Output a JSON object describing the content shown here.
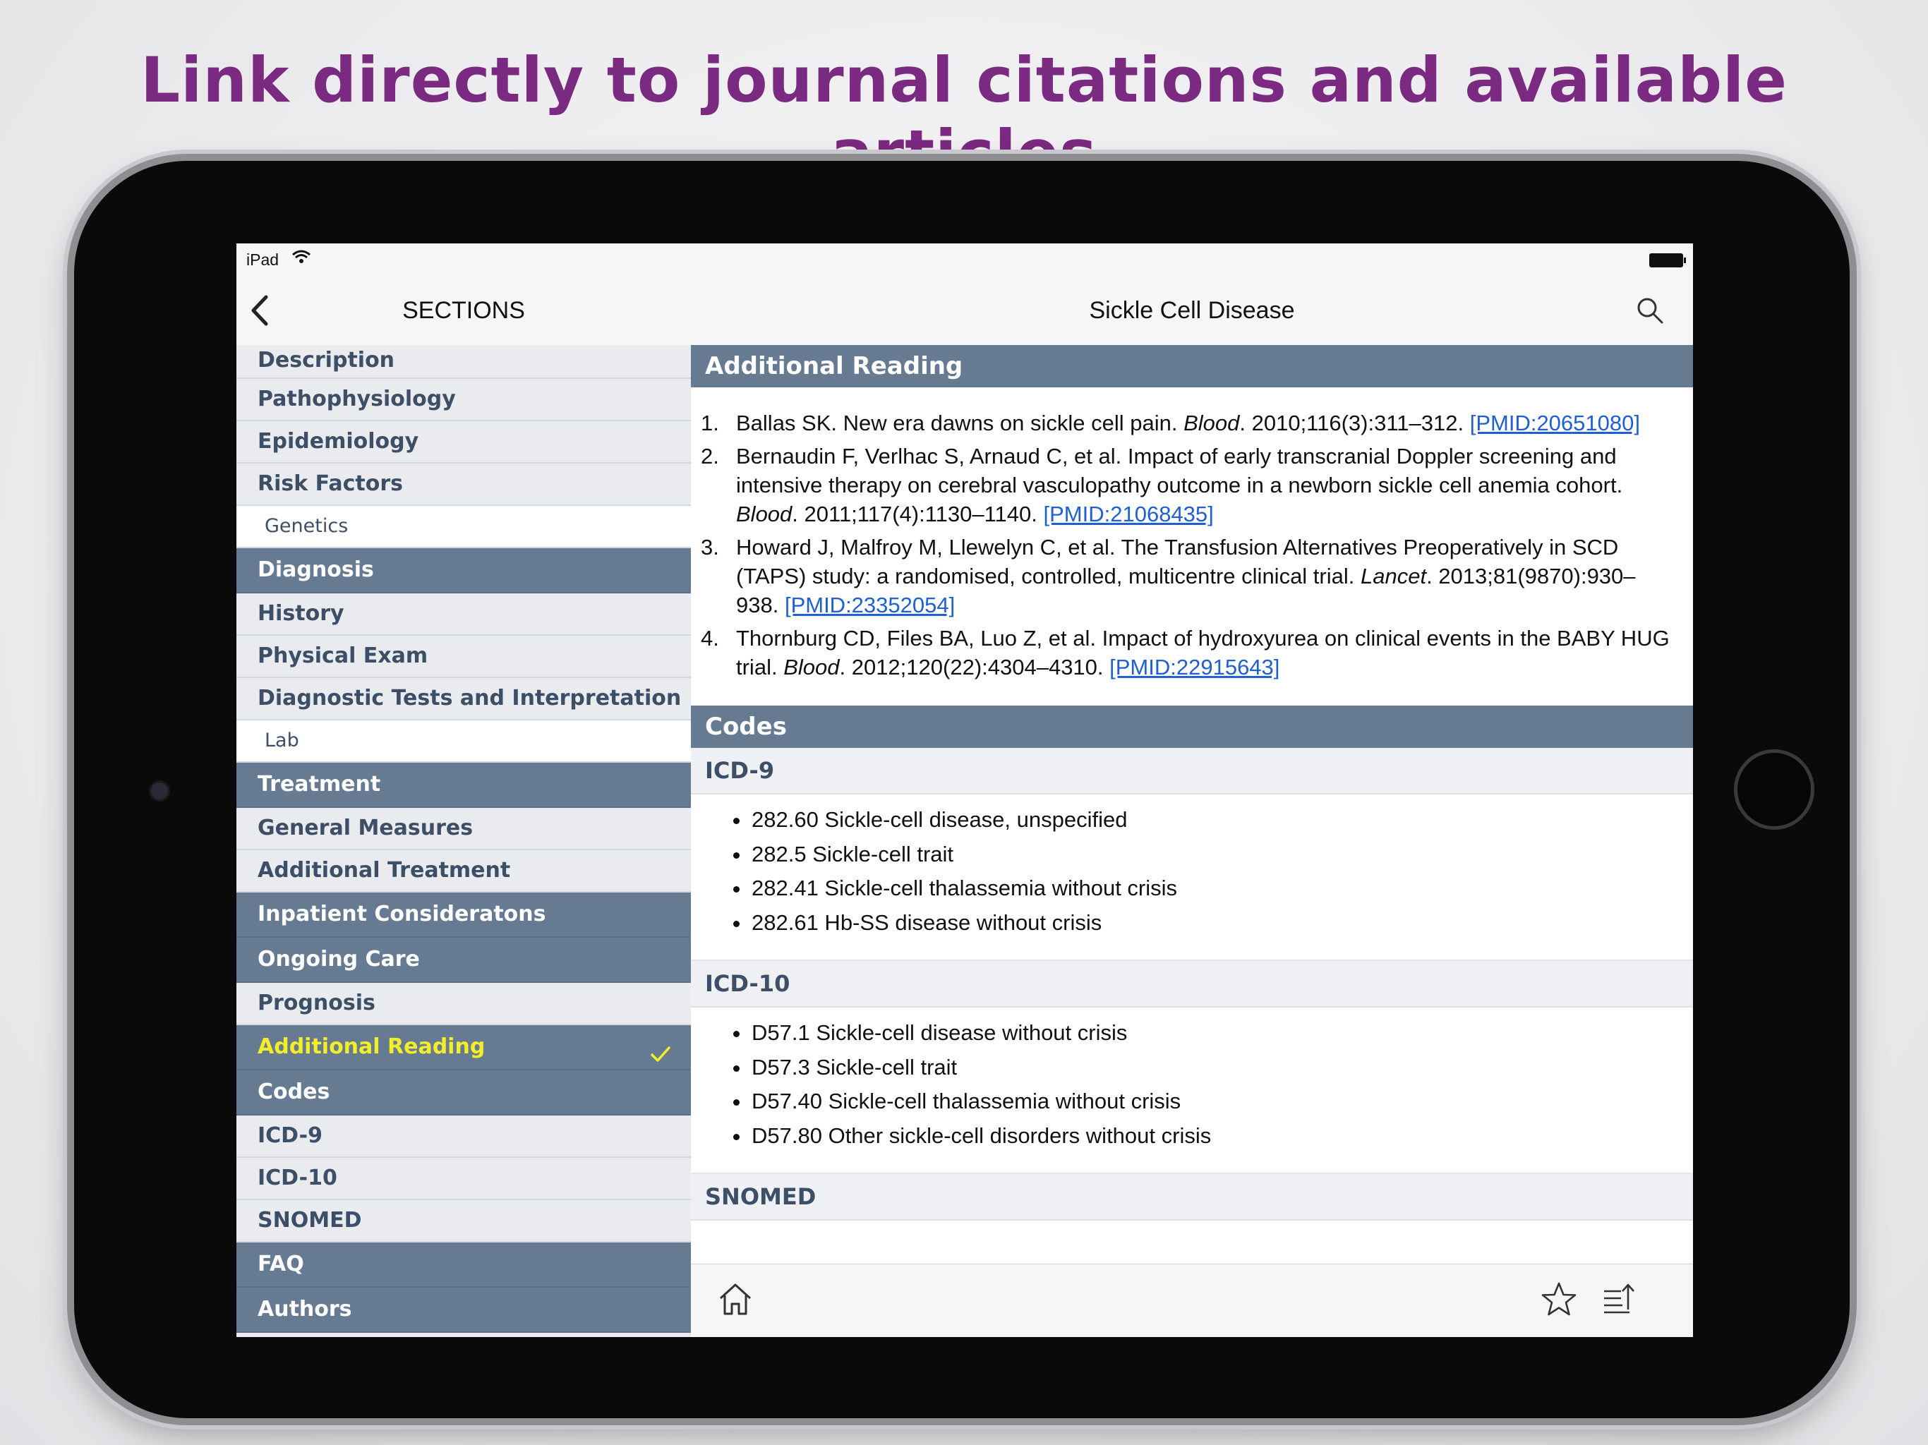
{
  "headline": "Link directly to journal citations and available articles",
  "status_bar": {
    "carrier": "iPad"
  },
  "sidebar": {
    "title": "SECTIONS",
    "items": [
      {
        "label": "Description",
        "type": "item"
      },
      {
        "label": "Pathophysiology",
        "type": "item"
      },
      {
        "label": "Epidemiology",
        "type": "item"
      },
      {
        "label": "Risk Factors",
        "type": "item"
      },
      {
        "label": "Genetics",
        "type": "sub"
      },
      {
        "label": "Diagnosis",
        "type": "head"
      },
      {
        "label": "History",
        "type": "item"
      },
      {
        "label": "Physical Exam",
        "type": "item"
      },
      {
        "label": "Diagnostic Tests and Interpretation",
        "type": "item"
      },
      {
        "label": "Lab",
        "type": "sub"
      },
      {
        "label": "Treatment",
        "type": "head"
      },
      {
        "label": "General Measures",
        "type": "item"
      },
      {
        "label": "Additional Treatment",
        "type": "item"
      },
      {
        "label": "Inpatient Consideratons",
        "type": "head"
      },
      {
        "label": "Ongoing Care",
        "type": "head"
      },
      {
        "label": "Prognosis",
        "type": "item"
      },
      {
        "label": "Additional Reading",
        "type": "active"
      },
      {
        "label": "Codes",
        "type": "head"
      },
      {
        "label": "ICD-9",
        "type": "item"
      },
      {
        "label": "ICD-10",
        "type": "item"
      },
      {
        "label": "SNOMED",
        "type": "item"
      },
      {
        "label": "FAQ",
        "type": "head"
      },
      {
        "label": "Authors",
        "type": "head"
      }
    ]
  },
  "main": {
    "title": "Sickle Cell Disease",
    "additional_reading": {
      "heading": "Additional Reading",
      "references": [
        {
          "num": "1.",
          "before": "Ballas SK. New era dawns on sickle cell pain. ",
          "journal": "Blood",
          "after": ". 2010;116(3):311–312. ",
          "pmid": "[PMID:20651080]"
        },
        {
          "num": "2.",
          "before": "Bernaudin F, Verlhac S, Arnaud C, et al. Impact of early transcranial Doppler screening and intensive therapy on cerebral vasculopathy outcome in a newborn sickle cell anemia cohort. ",
          "journal": "Blood",
          "after": ". 2011;117(4):1130–1140. ",
          "pmid": "[PMID:21068435]"
        },
        {
          "num": "3.",
          "before": "Howard J, Malfroy M, Llewelyn C, et al. The Transfusion Alternatives Preoperatively in SCD (TAPS) study: a randomised, controlled, multicentre clinical trial. ",
          "journal": "Lancet",
          "after": ". 2013;81(9870):930–938. ",
          "pmid": "[PMID:23352054]"
        },
        {
          "num": "4.",
          "before": "Thornburg CD, Files BA, Luo Z, et al. Impact of hydroxyurea on clinical events in the BABY HUG trial. ",
          "journal": "Blood",
          "after": ". 2012;120(22):4304–4310. ",
          "pmid": "[PMID:22915643]"
        }
      ]
    },
    "codes": {
      "heading": "Codes",
      "icd9": {
        "heading": "ICD-9",
        "items": [
          "282.60 Sickle-cell disease, unspecified",
          "282.5 Sickle-cell trait",
          "282.41 Sickle-cell thalassemia without crisis",
          "282.61 Hb-SS disease without crisis"
        ]
      },
      "icd10": {
        "heading": "ICD-10",
        "items": [
          "D57.1 Sickle-cell disease without crisis",
          "D57.3 Sickle-cell trait",
          "D57.40 Sickle-cell thalassemia without crisis",
          "D57.80 Other sickle-cell disorders without crisis"
        ]
      },
      "snomed": {
        "heading": "SNOMED"
      }
    }
  },
  "toolbar": {
    "icons": [
      "home-icon",
      "star-icon",
      "share-list-icon"
    ]
  },
  "colors": {
    "headline": "#7a2a80",
    "section_header": "#667a91",
    "active_label": "#f2ee2a",
    "link": "#1f5fcf",
    "sidebar_text": "#3d4f66"
  }
}
